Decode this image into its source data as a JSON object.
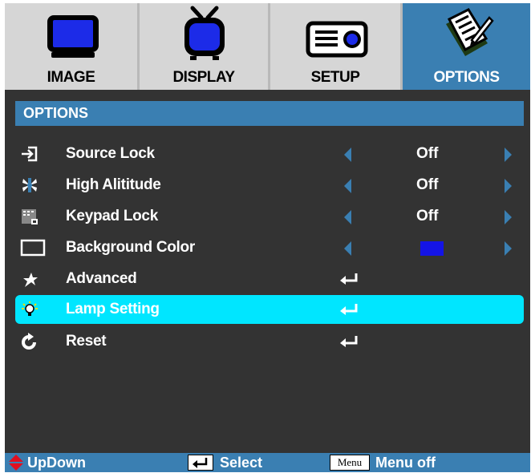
{
  "tabs": [
    {
      "label": "IMAGE",
      "icon": "monitor-icon",
      "active": false
    },
    {
      "label": "DISPLAY",
      "icon": "tv-icon",
      "active": false
    },
    {
      "label": "SETUP",
      "icon": "projector-icon",
      "active": false
    },
    {
      "label": "OPTIONS",
      "icon": "notepad-pen-icon",
      "active": true
    }
  ],
  "section_title": "OPTIONS",
  "items": [
    {
      "label": "Source Lock",
      "icon": "source-input-icon",
      "value": "Off",
      "type": "select"
    },
    {
      "label": "High Alititude",
      "icon": "fan-icon",
      "value": "Off",
      "type": "select"
    },
    {
      "label": "Keypad Lock",
      "icon": "keypad-icon",
      "value": "Off",
      "type": "select"
    },
    {
      "label": "Background Color",
      "icon": "rectangle-icon",
      "value_color": "#1414e6",
      "type": "color"
    },
    {
      "label": "Advanced",
      "icon": "star-icon",
      "type": "submenu"
    },
    {
      "label": "Lamp Setting",
      "icon": "lightbulb-icon",
      "type": "submenu",
      "selected": true
    },
    {
      "label": "Reset",
      "icon": "refresh-icon",
      "type": "submenu"
    }
  ],
  "footer": {
    "updown": "UpDown",
    "select": "Select",
    "menu_key": "Menu",
    "menu_off": "Menu off"
  },
  "colors": {
    "accent": "#3a7fb2",
    "selection": "#00e6ff",
    "background": "#333333",
    "tab_bg": "#d6d6d6",
    "arrow_red": "#e01020"
  }
}
